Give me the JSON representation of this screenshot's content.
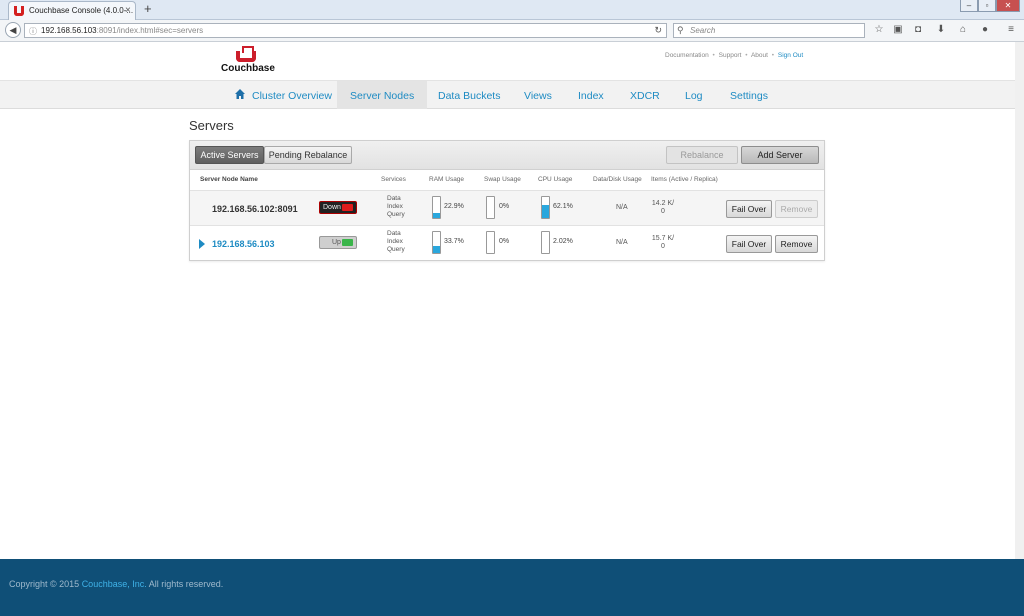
{
  "browser": {
    "tab_title": "Couchbase Console (4.0.0-...",
    "tab_close": "×",
    "new_tab": "+",
    "url_host": "192.168.56.103",
    "url_rest": ":8091/index.html#sec=servers",
    "search_placeholder": "Search",
    "window_min": "–",
    "window_max": "▫",
    "window_close": "✕"
  },
  "header": {
    "logo_text": "Couchbase",
    "links": [
      "Documentation",
      "Support",
      "About"
    ],
    "separator": "•",
    "signout": "Sign Out"
  },
  "nav": {
    "items": [
      "Cluster Overview",
      "Server Nodes",
      "Data Buckets",
      "Views",
      "Index",
      "XDCR",
      "Log",
      "Settings"
    ],
    "active": "Server Nodes"
  },
  "page": {
    "title": "Servers",
    "toolbar": {
      "active_servers": "Active Servers",
      "pending_rebalance": "Pending Rebalance",
      "rebalance": "Rebalance",
      "add_server": "Add Server"
    },
    "columns": {
      "node_name": "Server Node Name",
      "services": "Services",
      "ram": "RAM Usage",
      "swap": "Swap Usage",
      "cpu": "CPU Usage",
      "disk": "Data/Disk Usage",
      "items": "Items (Active / Replica)"
    },
    "servers": [
      {
        "name": "192.168.56.102:8091",
        "status": "Down",
        "services": [
          "Data",
          "Index",
          "Query"
        ],
        "ram": "22.9%",
        "ram_level": 0.229,
        "swap": "0%",
        "swap_level": 0,
        "cpu": "62.1%",
        "cpu_level": 0.621,
        "disk": "N/A",
        "items_active": "14.2 K/",
        "items_replica": "0",
        "failover": "Fail Over",
        "remove": "Remove"
      },
      {
        "name": "192.168.56.103",
        "status": "Up",
        "services": [
          "Data",
          "Index",
          "Query"
        ],
        "ram": "33.7%",
        "ram_level": 0.337,
        "swap": "0%",
        "swap_level": 0,
        "cpu": "2.02%",
        "cpu_level": 0.0202,
        "disk": "N/A",
        "items_active": "15.7 K/",
        "items_replica": "0",
        "failover": "Fail Over",
        "remove": "Remove"
      }
    ]
  },
  "footer": {
    "prefix": "Copyright © 2015 ",
    "brand": "Couchbase, Inc.",
    "suffix": " All rights reserved."
  },
  "colors": {
    "accent": "#1e8bc3",
    "down": "#e01c1c",
    "up": "#3ab54a",
    "gauge": "#2aa7dd",
    "footer": "#0f4f77"
  }
}
